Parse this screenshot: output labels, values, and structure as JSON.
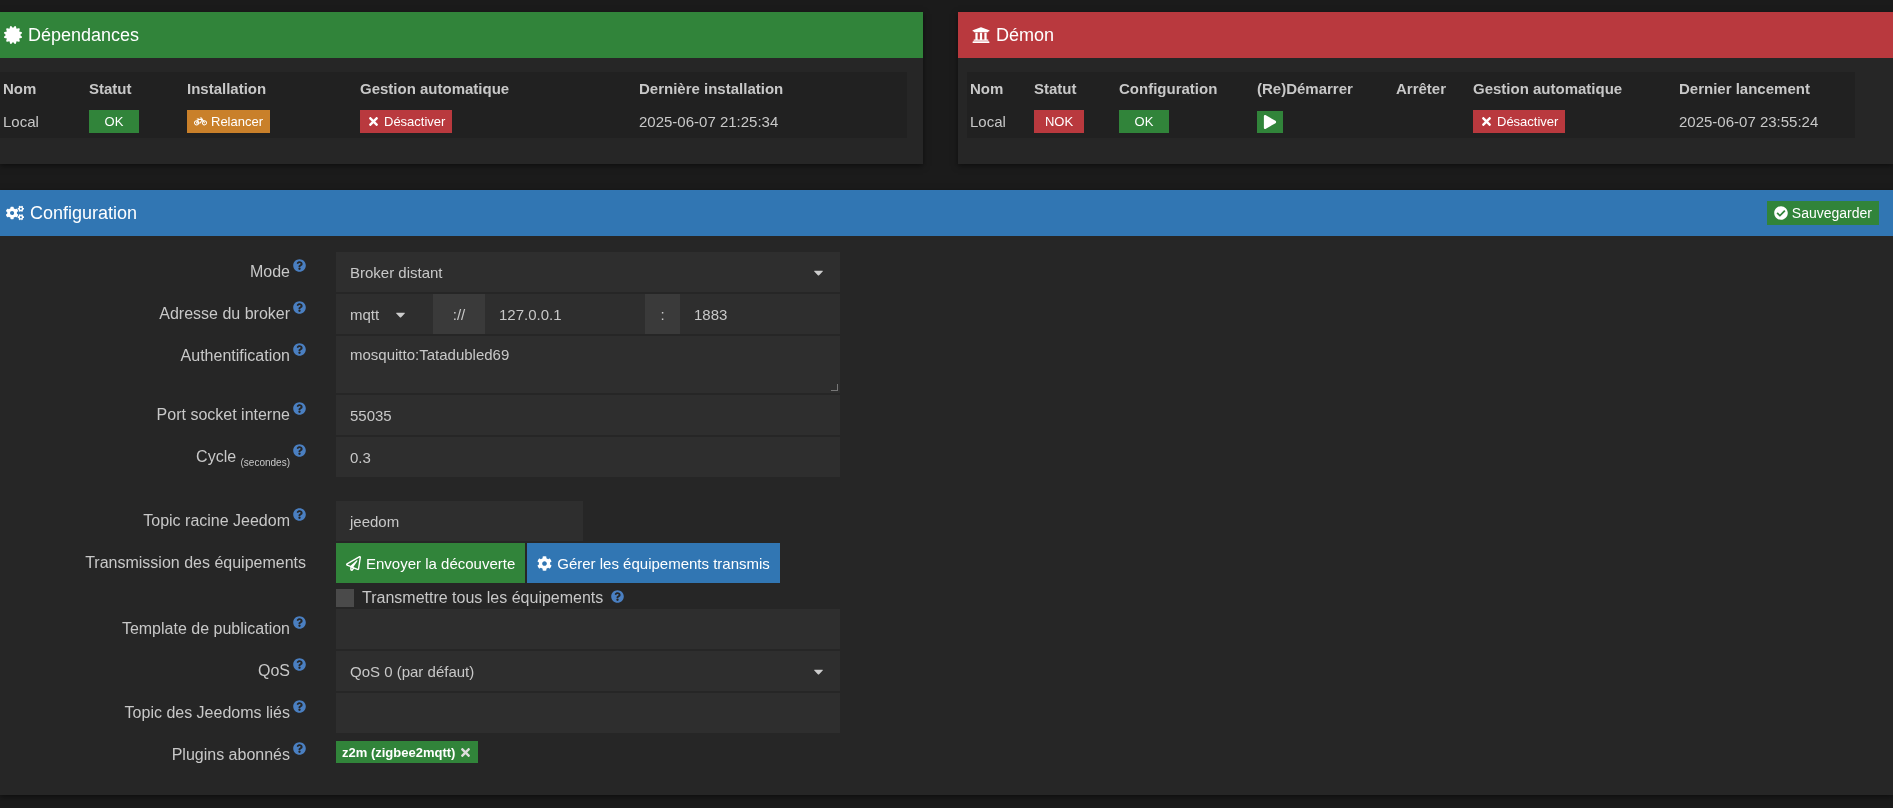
{
  "dependencies": {
    "title": "Dépendances",
    "columns": [
      "Nom",
      "Statut",
      "Installation",
      "Gestion automatique",
      "Dernière installation"
    ],
    "rows": [
      [
        {
          "kind": "text",
          "text": "Local"
        },
        {
          "kind": "status",
          "text": "OK",
          "ok": true
        },
        {
          "kind": "relaunch",
          "text": "Relancer"
        },
        {
          "kind": "disable",
          "text": "Désactiver"
        },
        {
          "kind": "text",
          "text": "2025-06-07 21:25:34"
        }
      ]
    ]
  },
  "daemon": {
    "title": "Démon",
    "columns": [
      "Nom",
      "Statut",
      "Configuration",
      "(Re)Démarrer",
      "Arrêter",
      "Gestion automatique",
      "Dernier lancement"
    ],
    "rows": [
      [
        {
          "kind": "text",
          "text": "Local"
        },
        {
          "kind": "status",
          "text": "NOK",
          "ok": false
        },
        {
          "kind": "status",
          "text": "OK",
          "ok": true
        },
        {
          "kind": "play"
        },
        {
          "kind": "empty"
        },
        {
          "kind": "disable",
          "text": "Désactiver"
        },
        {
          "kind": "text",
          "text": "2025-06-07 23:55:24"
        }
      ]
    ]
  },
  "configuration": {
    "title": "Configuration",
    "save_button": "Sauvegarder",
    "groups": [
      [
        {
          "kind": "select",
          "label": "Mode",
          "help": true,
          "value": "Broker distant"
        },
        {
          "kind": "broker",
          "label": "Adresse du broker",
          "help": true,
          "scheme": "mqtt",
          "separator": "://",
          "host": "127.0.0.1",
          "colon": ":",
          "port": "1883"
        },
        {
          "kind": "textarea",
          "label": "Authentification",
          "help": true,
          "value": "mosquitto:Tatadubled69"
        },
        {
          "kind": "input",
          "label": "Port socket interne",
          "help": true,
          "value": "55035"
        },
        {
          "kind": "input",
          "label": "Cycle $_{(secondes)}$",
          "help": true,
          "value": "0.3"
        }
      ],
      [
        {
          "kind": "short",
          "label": "Topic racine Jeedom",
          "help": true,
          "value": "jeedom"
        },
        {
          "kind": "buttons",
          "label": "Transmission des équipements",
          "help": false,
          "buttons": [
            {
              "kind": "send",
              "text": "Envoyer la découverte"
            },
            {
              "kind": "manage",
              "text": "Gérer les équipements transmis"
            }
          ],
          "checkbox": {
            "label": "Transmettre tous les équipements",
            "checked": false,
            "help": true
          }
        },
        {
          "kind": "input",
          "label": "Template de publication",
          "help": true
        },
        {
          "kind": "select",
          "label": "QoS",
          "help": true,
          "value": "QoS 0 (par défaut)"
        },
        {
          "kind": "input",
          "label": "Topic des Jeedoms liés",
          "help": true
        },
        {
          "kind": "tags",
          "label": "Plugins abonnés",
          "help": true,
          "tags": [
            "z2m (zigbee2mqtt)"
          ]
        }
      ]
    ]
  }
}
